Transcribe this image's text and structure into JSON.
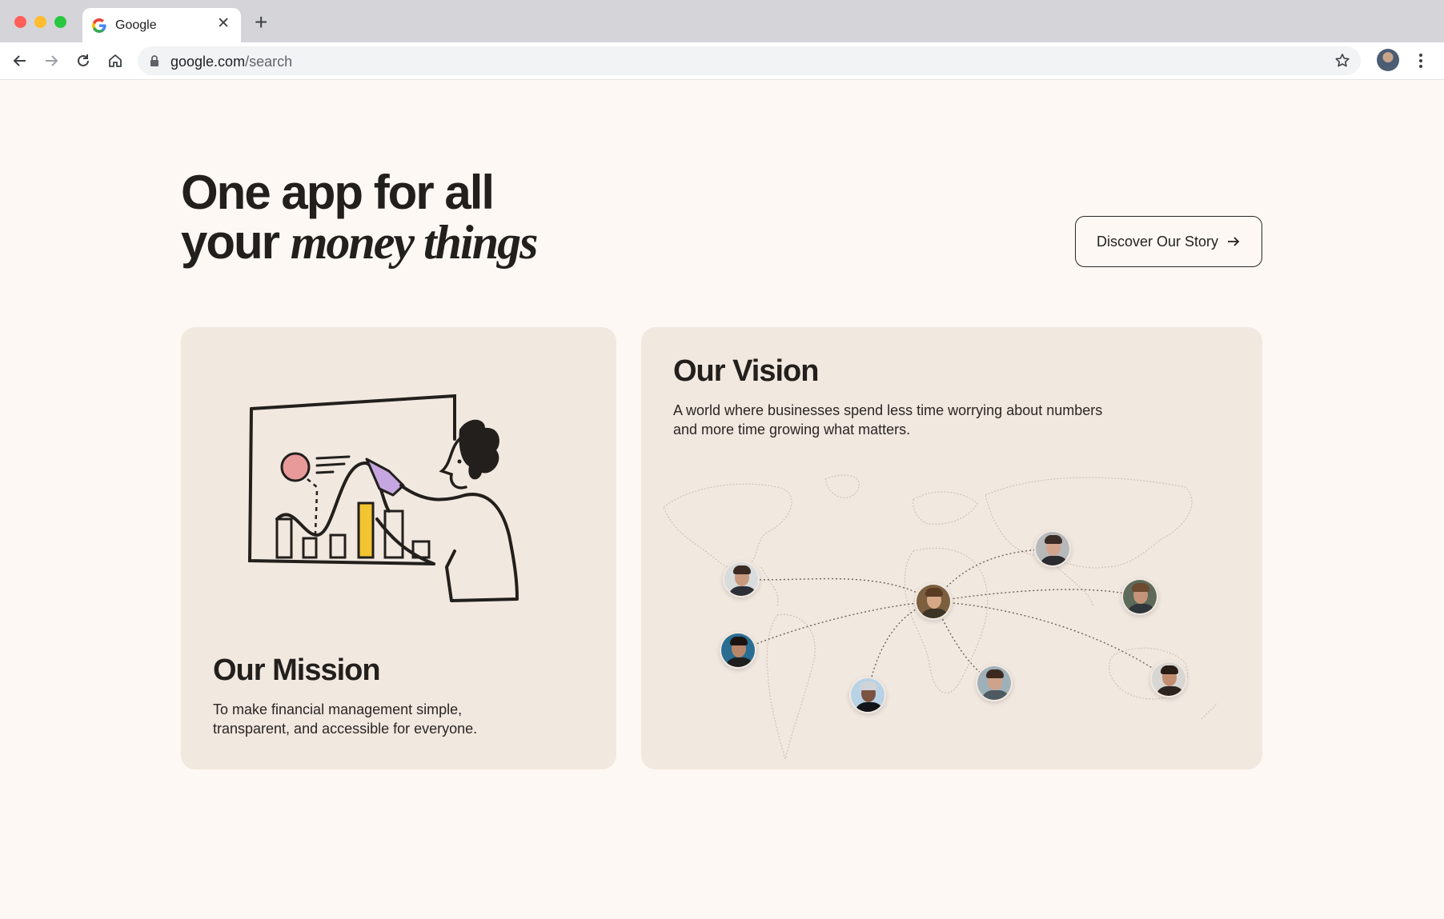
{
  "browser": {
    "tab_title": "Google",
    "url_domain": "google.com",
    "url_path": "/search"
  },
  "hero": {
    "headline_line1": "One app for all",
    "headline_line2_plain": "your",
    "headline_line2_italic": "money things",
    "cta_label": "Discover Our Story"
  },
  "mission": {
    "title": "Our Mission",
    "text": "To make financial management simple, transparent, and accessible for everyone."
  },
  "vision": {
    "title": "Our Vision",
    "text": "A world where businesses spend less time worrying about numbers and more time growing what matters."
  },
  "colors": {
    "page_bg": "#fdf8f4",
    "card_bg": "#f1e8e0",
    "ink": "#221f1c",
    "accent_pink": "#e89a9a",
    "accent_yellow": "#f2c430",
    "accent_purple": "#c5a6e0"
  }
}
